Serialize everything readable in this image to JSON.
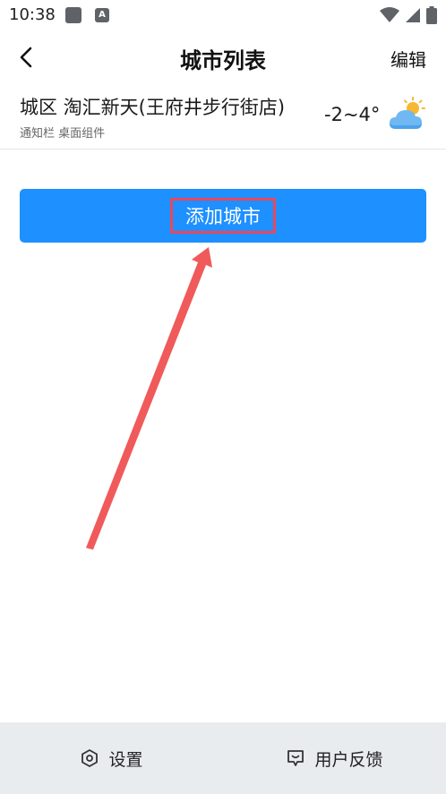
{
  "status_bar": {
    "time": "10:38",
    "a_glyph": "A"
  },
  "header": {
    "title": "城市列表",
    "edit_label": "编辑"
  },
  "city": {
    "name": "城区 淘汇新天(王府井步行街店)",
    "subtitle": "通知栏 桌面组件",
    "temperature": "-2~4°",
    "weather_icon": "partly-cloudy-icon"
  },
  "add_city": {
    "label": "添加城市"
  },
  "bottom_bar": {
    "settings_label": "设置",
    "feedback_label": "用户反馈"
  },
  "colors": {
    "accent": "#1e90ff",
    "highlight_box": "#e8485e",
    "bottom_bar_bg": "#e9ecef",
    "arrow": "#f05a5a"
  }
}
